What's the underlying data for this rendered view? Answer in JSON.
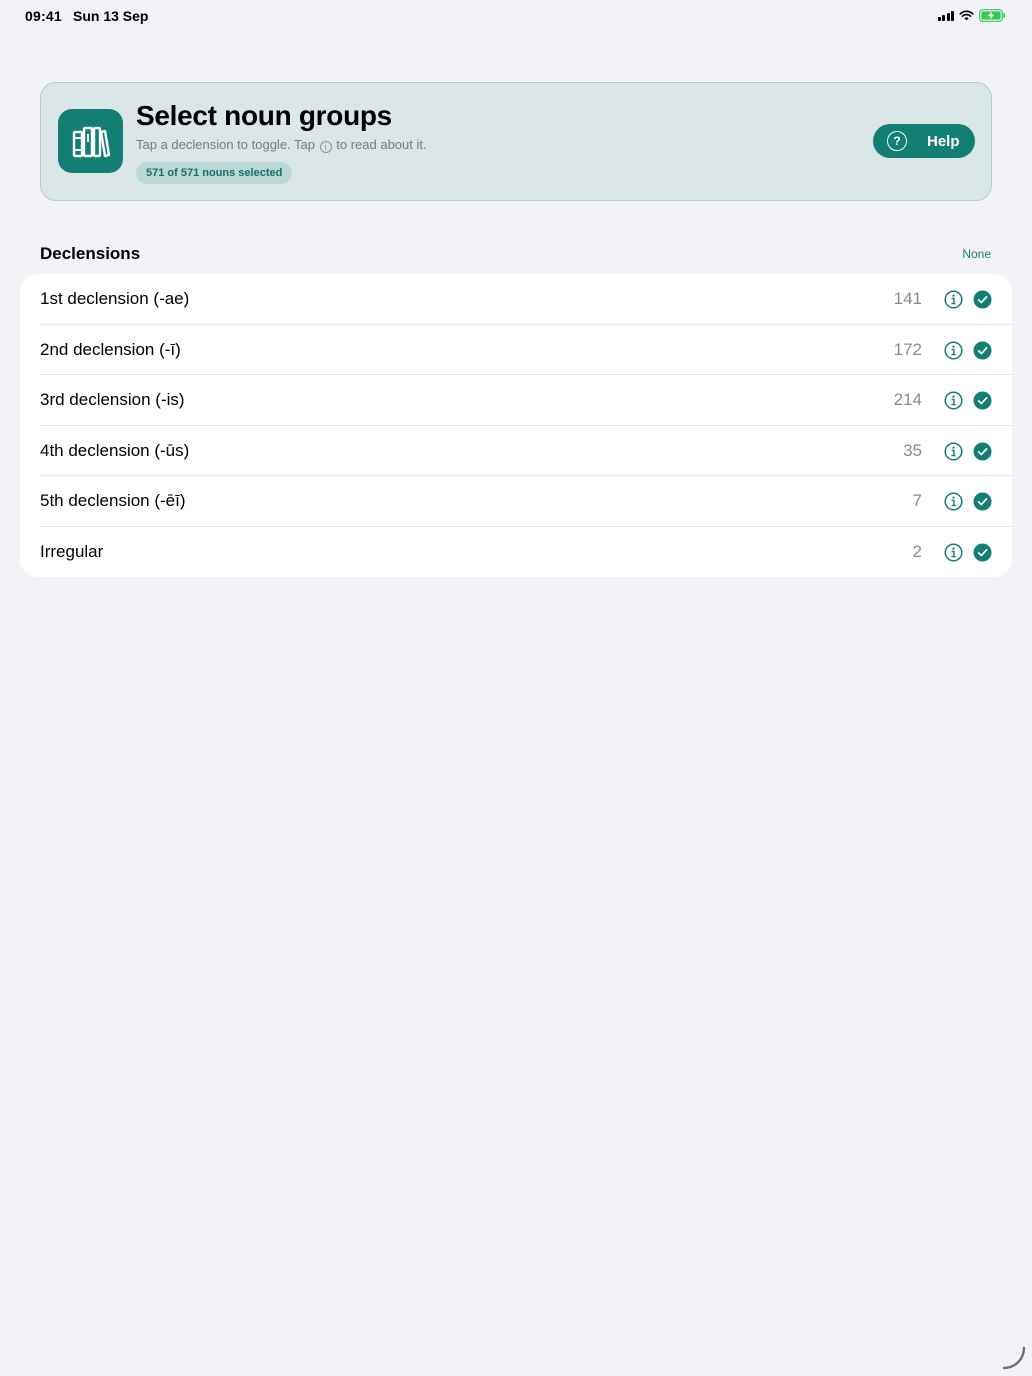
{
  "status_bar": {
    "time": "09:41",
    "date": "Sun 13 Sep"
  },
  "header": {
    "title": "Select noun groups",
    "subtitle_before": "Tap a declension to toggle. Tap",
    "subtitle_info_glyph": "i",
    "subtitle_after": "to read about it.",
    "count_pill": "571 of 571 nouns selected",
    "help_label": "Help",
    "help_glyph": "?",
    "icon": "books-icon"
  },
  "section": {
    "title": "Declensions",
    "none_label": "None"
  },
  "declensions": [
    {
      "label": "1st declension (-ae)",
      "count": "141",
      "selected": true
    },
    {
      "label": "2nd declension (-ī)",
      "count": "172",
      "selected": true
    },
    {
      "label": "3rd declension (-is)",
      "count": "214",
      "selected": true
    },
    {
      "label": "4th declension (-ūs)",
      "count": "35",
      "selected": true
    },
    {
      "label": "5th declension (-ēī)",
      "count": "7",
      "selected": true
    },
    {
      "label": "Irregular",
      "count": "2",
      "selected": true
    }
  ],
  "colors": {
    "accent": "#137e73",
    "card_background": "#dae6e7",
    "page_background": "#f2f2f7",
    "battery": "#34c759"
  }
}
